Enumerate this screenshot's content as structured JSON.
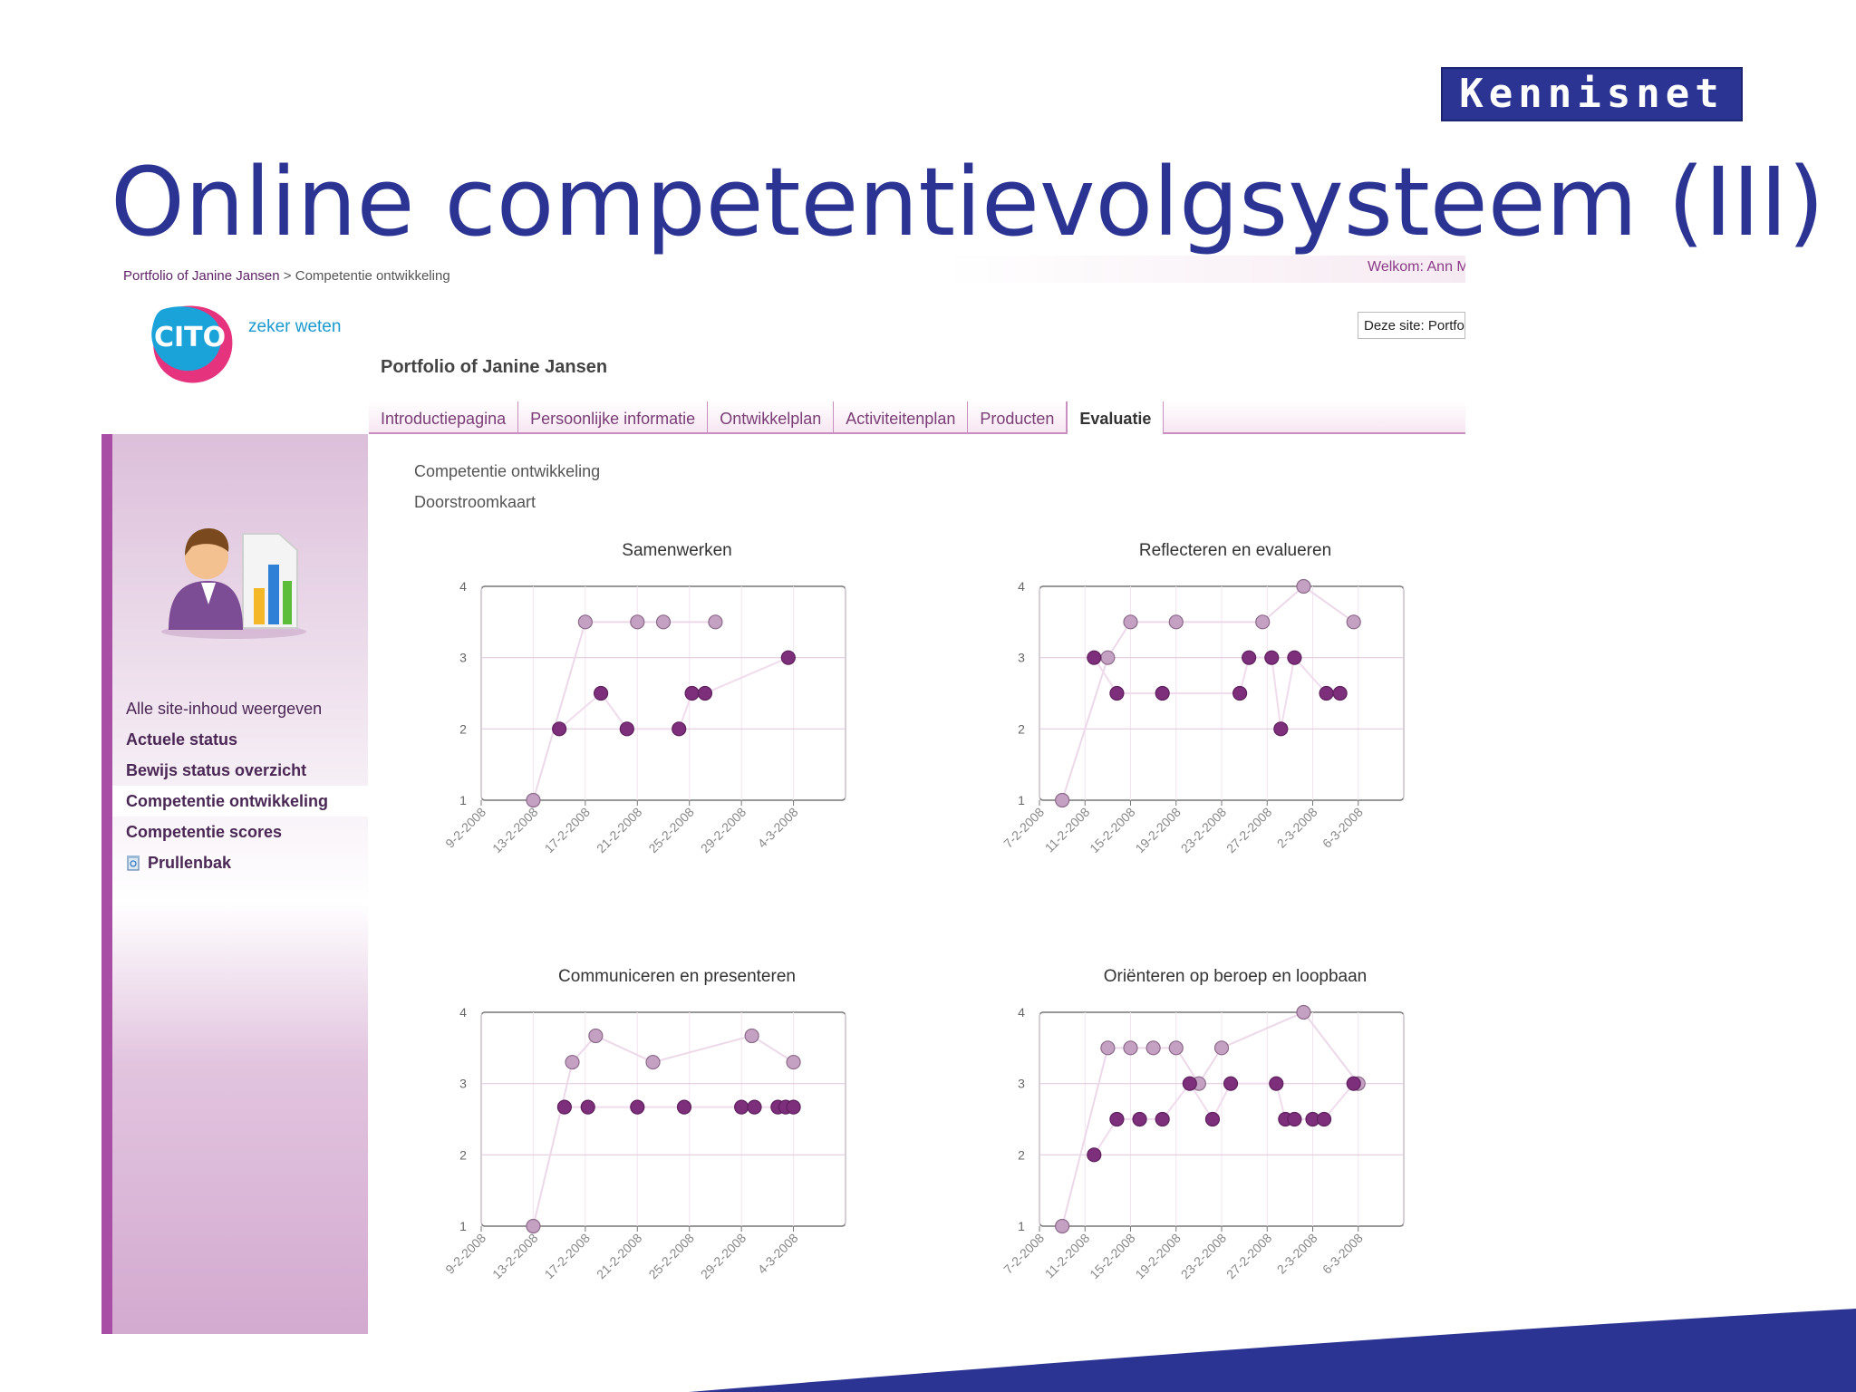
{
  "slide": {
    "brand": "Kennisnet",
    "title": "Online competentievolgsysteem (III)",
    "colors": {
      "title": "#2b3493",
      "accent": "#a84ea4"
    }
  },
  "app": {
    "breadcrumb": {
      "root": "Portfolio of Janine Jansen",
      "separator": ">",
      "current": "Competentie ontwikkeling"
    },
    "welcome": "Welkom: Ann M",
    "logo_tagline": "zeker weten",
    "site_search": "Deze site: Portfolio",
    "portfolio_heading": "Portfolio of Janine Jansen",
    "tabs": [
      {
        "label": "Introductiepagina"
      },
      {
        "label": "Persoonlijke informatie"
      },
      {
        "label": "Ontwikkelplan"
      },
      {
        "label": "Activiteitenplan"
      },
      {
        "label": "Producten"
      },
      {
        "label": "Evaluatie",
        "active": true
      }
    ],
    "sidebar": {
      "illustration_icon": "person-with-bar-chart-icon",
      "items": [
        {
          "label": "Alle site-inhoud weergeven"
        },
        {
          "label": "Actuele status"
        },
        {
          "label": "Bewijs status overzicht"
        },
        {
          "label": "Competentie ontwikkeling",
          "active": true
        },
        {
          "label": "Competentie scores"
        },
        {
          "label": "Prullenbak",
          "icon": "recycle-bin-icon"
        }
      ]
    },
    "main": {
      "section_title": "Competentie ontwikkeling",
      "subtitle": "Doorstroomkaart"
    }
  },
  "chart_data": [
    {
      "type": "scatter",
      "title": "Samenwerken",
      "ylim": [
        1,
        4
      ],
      "yticks": [
        "1",
        "2",
        "3",
        "4"
      ],
      "xticks": [
        "9-2-2008",
        "13-2-2008",
        "17-2-2008",
        "21-2-2008",
        "25-2-2008",
        "29-2-2008",
        "4-3-2008"
      ],
      "series": [
        {
          "color": "#c4a0c2",
          "points": [
            [
              1.0,
              1.0
            ],
            [
              2.0,
              3.5
            ],
            [
              3.0,
              3.5
            ],
            [
              3.5,
              3.5
            ],
            [
              4.5,
              3.5
            ]
          ]
        },
        {
          "color": "#7d2f7c",
          "points": [
            [
              1.5,
              2.0
            ],
            [
              2.3,
              2.5
            ],
            [
              2.8,
              2.0
            ],
            [
              3.8,
              2.0
            ],
            [
              4.05,
              2.5
            ],
            [
              4.3,
              2.5
            ],
            [
              5.9,
              3.0
            ]
          ]
        }
      ]
    },
    {
      "type": "scatter",
      "title": "Reflecteren en evalueren",
      "ylim": [
        1,
        4
      ],
      "yticks": [
        "1",
        "2",
        "3",
        "4"
      ],
      "xticks": [
        "7-2-2008",
        "11-2-2008",
        "15-2-2008",
        "19-2-2008",
        "23-2-2008",
        "27-2-2008",
        "2-3-2008",
        "6-3-2008"
      ],
      "series": [
        {
          "color": "#c4a0c2",
          "points": [
            [
              0.5,
              1.0
            ],
            [
              1.5,
              3.0
            ],
            [
              2.0,
              3.5
            ],
            [
              3.0,
              3.5
            ],
            [
              4.9,
              3.5
            ],
            [
              5.8,
              4.0
            ],
            [
              6.9,
              3.5
            ]
          ]
        },
        {
          "color": "#7d2f7c",
          "points": [
            [
              1.2,
              3.0
            ],
            [
              1.7,
              2.5
            ],
            [
              2.7,
              2.5
            ],
            [
              4.4,
              2.5
            ],
            [
              4.6,
              3.0
            ],
            [
              5.1,
              3.0
            ],
            [
              5.3,
              2.0
            ],
            [
              5.6,
              3.0
            ],
            [
              6.3,
              2.5
            ],
            [
              6.6,
              2.5
            ]
          ]
        }
      ]
    },
    {
      "type": "scatter",
      "title": "Communiceren en presenteren",
      "ylim": [
        1,
        4
      ],
      "yticks": [
        "1",
        "2",
        "3",
        "4"
      ],
      "xticks": [
        "9-2-2008",
        "13-2-2008",
        "17-2-2008",
        "21-2-2008",
        "25-2-2008",
        "29-2-2008",
        "4-3-2008"
      ],
      "series": [
        {
          "color": "#c4a0c2",
          "points": [
            [
              1.0,
              1.0
            ],
            [
              1.75,
              3.3
            ],
            [
              2.2,
              3.67
            ],
            [
              3.3,
              3.3
            ],
            [
              5.2,
              3.67
            ],
            [
              6.0,
              3.3
            ]
          ]
        },
        {
          "color": "#7d2f7c",
          "points": [
            [
              1.6,
              2.67
            ],
            [
              2.05,
              2.67
            ],
            [
              3.0,
              2.67
            ],
            [
              3.9,
              2.67
            ],
            [
              5.0,
              2.67
            ],
            [
              5.25,
              2.67
            ],
            [
              5.7,
              2.67
            ],
            [
              5.85,
              2.67
            ],
            [
              6.0,
              2.67
            ]
          ]
        }
      ]
    },
    {
      "type": "scatter",
      "title": "Oriënteren op beroep en loopbaan",
      "ylim": [
        1,
        4
      ],
      "yticks": [
        "1",
        "2",
        "3",
        "4"
      ],
      "xticks": [
        "7-2-2008",
        "11-2-2008",
        "15-2-2008",
        "19-2-2008",
        "23-2-2008",
        "27-2-2008",
        "2-3-2008",
        "6-3-2008"
      ],
      "series": [
        {
          "color": "#c4a0c2",
          "points": [
            [
              0.5,
              1.0
            ],
            [
              1.5,
              3.5
            ],
            [
              2.0,
              3.5
            ],
            [
              2.5,
              3.5
            ],
            [
              3.0,
              3.5
            ],
            [
              3.5,
              3.0
            ],
            [
              4.0,
              3.5
            ],
            [
              5.8,
              4.0
            ],
            [
              7.0,
              3.0
            ]
          ]
        },
        {
          "color": "#7d2f7c",
          "points": [
            [
              1.2,
              2.0
            ],
            [
              1.7,
              2.5
            ],
            [
              2.2,
              2.5
            ],
            [
              2.7,
              2.5
            ],
            [
              3.3,
              3.0
            ],
            [
              3.8,
              2.5
            ],
            [
              4.2,
              3.0
            ],
            [
              5.2,
              3.0
            ],
            [
              5.4,
              2.5
            ],
            [
              5.6,
              2.5
            ],
            [
              6.0,
              2.5
            ],
            [
              6.25,
              2.5
            ],
            [
              6.9,
              3.0
            ]
          ]
        }
      ]
    }
  ]
}
